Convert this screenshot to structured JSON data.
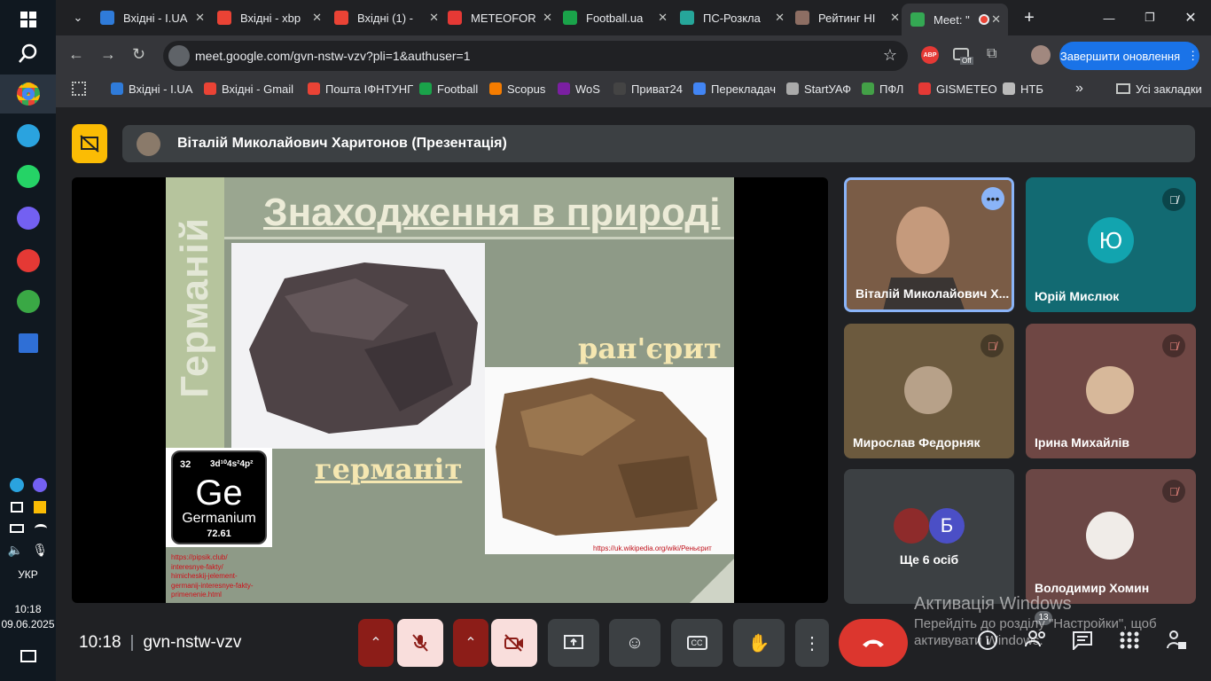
{
  "taskbar": {
    "lang": "УКР",
    "time": "10:18",
    "date": "09.06.2025"
  },
  "browser": {
    "tabs": [
      {
        "label": "Вхідні - I.UA",
        "icon": "iua-icon",
        "color": "#2f7bd9"
      },
      {
        "label": "Вхідні - xbp",
        "icon": "gmail-icon",
        "color": "#ea4335"
      },
      {
        "label": "Вхідні (1) -",
        "icon": "gmail-icon",
        "color": "#ea4335"
      },
      {
        "label": "METEOFOR",
        "icon": "meteofor-icon",
        "color": "#e53935"
      },
      {
        "label": "Football.ua",
        "icon": "football-icon",
        "color": "#1aa34a"
      },
      {
        "label": "ПС-Розкла",
        "icon": "ps-icon",
        "color": "#26a69a"
      },
      {
        "label": "Рейтинг НІ",
        "icon": "rating-icon",
        "color": "#8d6e63"
      },
      {
        "label": "Meet: \"",
        "icon": "meet-icon",
        "color": "#34a853"
      }
    ],
    "address": "meet.google.com/gvn-nstw-vzv?pli=1&authuser=1",
    "abp_badge": "ABP",
    "ext_badge": "Off",
    "update_label": "Завершити оновлення",
    "bookmarks": [
      {
        "label": "Вхідні - I.UA",
        "color": "#2f7bd9"
      },
      {
        "label": "Вхідні - Gmail",
        "color": "#ea4335"
      },
      {
        "label": "Пошта ІФНТУНГ",
        "color": "#ea4335"
      },
      {
        "label": "Football",
        "color": "#1aa34a"
      },
      {
        "label": "Scopus",
        "color": "#f57c00"
      },
      {
        "label": "WoS",
        "color": "#7b1fa2"
      },
      {
        "label": "Приват24",
        "color": "#444444"
      },
      {
        "label": "Перекладач",
        "color": "#4285f4"
      },
      {
        "label": "StartУАФ",
        "color": "#aaaaaa"
      },
      {
        "label": "ПФЛ",
        "color": "#43a047"
      },
      {
        "label": "GISMETEO",
        "color": "#e53935"
      },
      {
        "label": "НТБ",
        "color": "#bbbbbb"
      }
    ],
    "all_bookmarks": "Усі закладки"
  },
  "meet": {
    "presenter_bar": "Віталій Миколайович Харитонов (Презентація)",
    "slide": {
      "side_title": "Германій",
      "title": "Знаходження в природі",
      "label1": "германіт",
      "label2": "ран'єрит",
      "ge_number": "32",
      "ge_config": "3d¹⁰4s²4p²",
      "ge_symbol": "Ge",
      "ge_name": "Germanium",
      "ge_mass": "72.61",
      "link1_lines": [
        "https://pipsik.club/",
        "interesnye-fakty/",
        "himicheskij-jelement-",
        "germanij-interesnye-fakty-",
        "primenenie.html"
      ],
      "link2": "https://uk.wikipedia.org/wiki/Реньєрит"
    },
    "participants": [
      {
        "name": "Віталій Миколайович Х...",
        "type": "video"
      },
      {
        "name": "Юрій Мислюк",
        "initial": "Ю",
        "muted": true
      },
      {
        "name": "Мирослав Федорняк",
        "muted": true
      },
      {
        "name": "Ірина Михайлів",
        "muted": true
      },
      {
        "name": "Ще 6 осіб",
        "initial": "Б"
      },
      {
        "name": "Володимир Хомин",
        "muted": true
      }
    ],
    "clock": "10:18",
    "meeting_code": "gvn-nstw-vzv",
    "people_count": "13",
    "watermark_title": "Активація Windows",
    "watermark_text": "Перейдіть до розділу \"Настройки\", щоб активувати Windows."
  }
}
